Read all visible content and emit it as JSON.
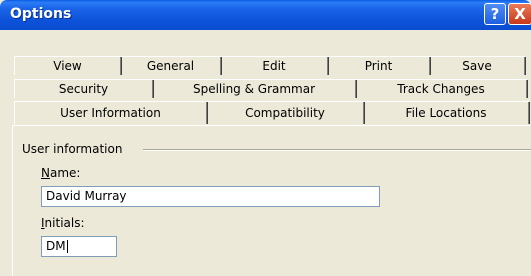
{
  "window": {
    "title": "Options",
    "help_label": "?",
    "close_label": "X"
  },
  "tabs": {
    "row1": [
      "View",
      "General",
      "Edit",
      "Print",
      "Save"
    ],
    "row2": [
      "Security",
      "Spelling & Grammar",
      "Track Changes"
    ],
    "row3": [
      "User Information",
      "Compatibility",
      "File Locations"
    ],
    "active": "User Information"
  },
  "user_info": {
    "group_label": "User information",
    "name_label": "Name:",
    "name_value": "David Murray",
    "initials_label": "Initials:",
    "initials_value": "DM"
  }
}
